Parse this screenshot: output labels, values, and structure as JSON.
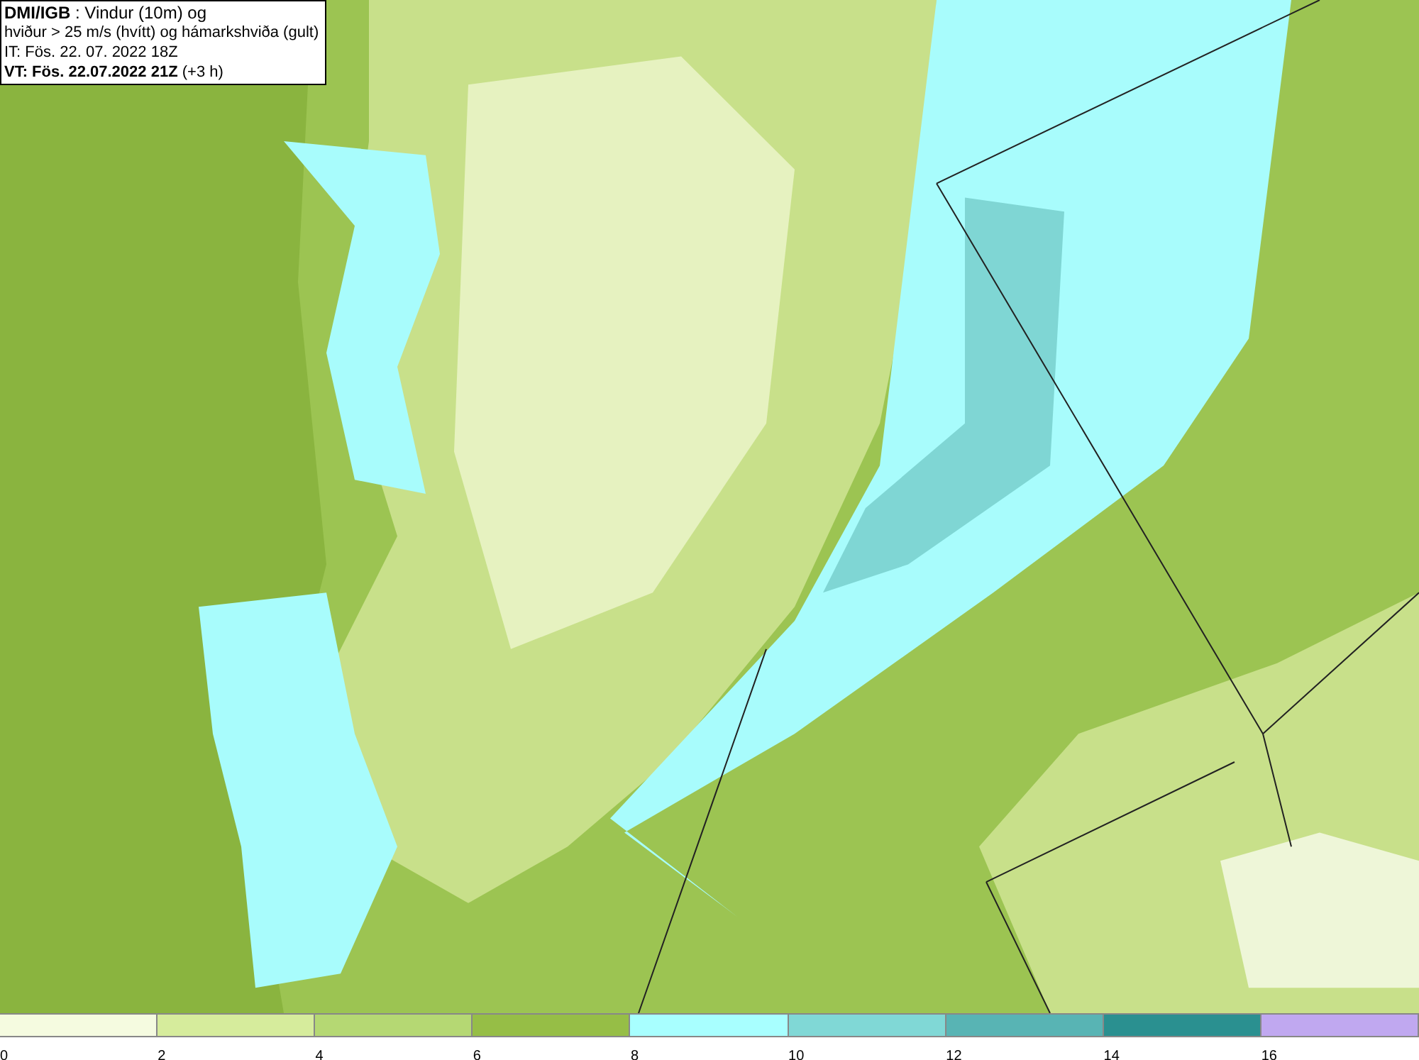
{
  "info_box": {
    "lines": [
      "**DMI/IGB** : Vindur (10m) og",
      "hviður > 25 m/s (hvítt) og hámarkshviða (gult)",
      "IT: Fös. 22. 07. 2022 18Z",
      "**VT: Fös. 22.07.2022 21Z** (+3 h)"
    ]
  },
  "legend": [
    {
      "label": "0",
      "color": "#f5fbe0"
    },
    {
      "label": "2",
      "color": "#d6ec9c"
    },
    {
      "label": "4",
      "color": "#b5d873"
    },
    {
      "label": "6",
      "color": "#96be46"
    },
    {
      "label": "8",
      "color": "#a8ffff"
    },
    {
      "label": "10",
      "color": "#80d8d6"
    },
    {
      "label": "12",
      "color": "#58b4b4"
    },
    {
      "label": "14",
      "color": "#2a9090"
    },
    {
      "label": "16",
      "color": "#c0a8f0"
    }
  ]
}
